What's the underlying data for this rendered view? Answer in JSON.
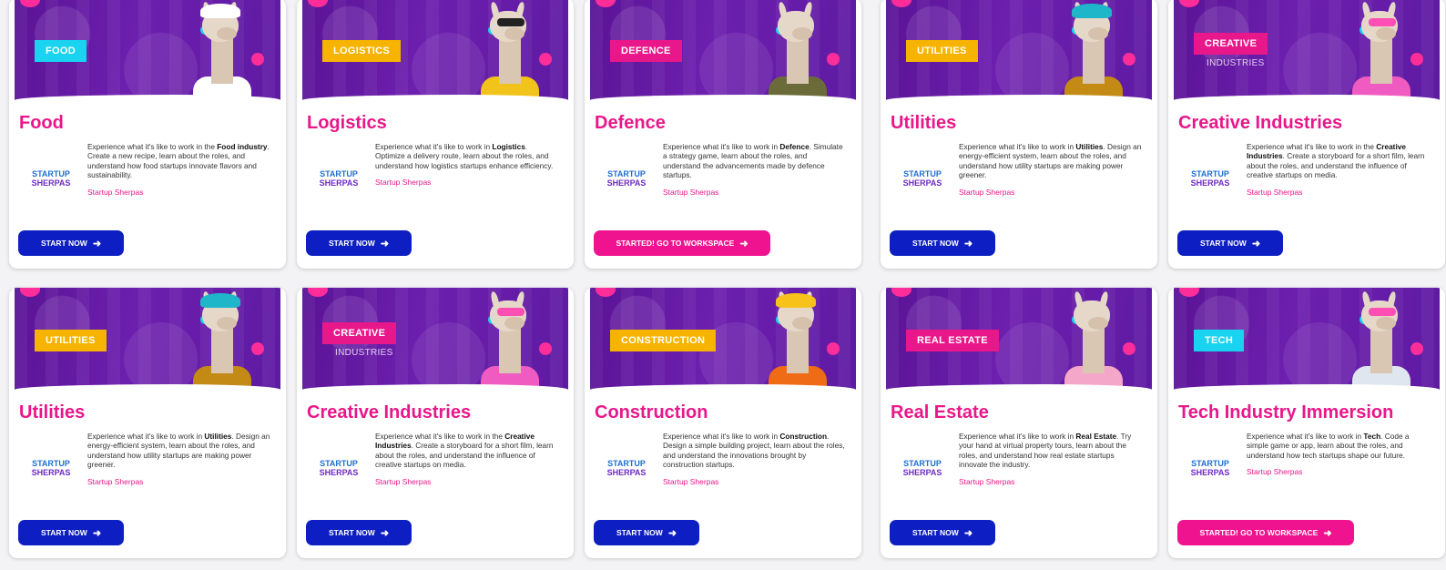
{
  "org_name": "Startup Sherpas",
  "logo": {
    "line1": "STARTUP",
    "line2": "SHERPAS"
  },
  "buttons": {
    "start": "START NOW",
    "started": "STARTED! GO TO WORKSPACE",
    "arrow_icon": "arrow-right-icon"
  },
  "cards": [
    {
      "tag": "FOOD",
      "tag_color": "#19d3f0",
      "tag_sub": "",
      "title": "Food",
      "desc_pre": "Experience what it's like to work in the ",
      "desc_bold": "Food industry",
      "desc_post": ". Create a new recipe, learn about the roles, and understand how food startups innovate flavors and sustainability.",
      "button": "start",
      "accessory": "chef-hat"
    },
    {
      "tag": "LOGISTICS",
      "tag_color": "#f6b400",
      "tag_sub": "",
      "title": "Logistics",
      "desc_pre": "Experience what it's like to work in ",
      "desc_bold": "Logistics",
      "desc_post": ". Optimize a delivery route, learn about the roles, and understand how logistics startups enhance efficiency.",
      "button": "start",
      "accessory": "sunglasses"
    },
    {
      "tag": "DEFENCE",
      "tag_color": "#e8178a",
      "tag_sub": "",
      "title": "Defence",
      "desc_pre": "Experience what it's like to work in ",
      "desc_bold": "Defence",
      "desc_post": ". Simulate a strategy game, learn about the roles, and understand the advancements made by defence startups.",
      "button": "started",
      "accessory": "military"
    },
    {
      "tag": "UTILITIES",
      "tag_color": "#f6b400",
      "tag_sub": "",
      "title": "Utilities",
      "desc_pre": "Experience what it's like to work in ",
      "desc_bold": "Utilities",
      "desc_post": ". Design an energy-efficient system, learn about the roles, and understand how utility startups are making power greener.",
      "button": "start",
      "accessory": "helmet"
    },
    {
      "tag": "CREATIVE",
      "tag_color": "#e8178a",
      "tag_sub": "INDUSTRIES",
      "title": "Creative Industries",
      "desc_pre": "Experience what it's like to work in the ",
      "desc_bold": "Creative Industries",
      "desc_post": ". Create a storyboard for a short film, learn about the roles, and understand the influence of creative startups on media.",
      "button": "start",
      "accessory": "pink-glasses"
    },
    {
      "tag": "UTILITIES",
      "tag_color": "#f6b400",
      "tag_sub": "",
      "title": "Utilities",
      "desc_pre": "Experience what it's like to work in ",
      "desc_bold": "Utilities",
      "desc_post": ". Design an energy-efficient system, learn about the roles, and understand how utility startups are making power greener.",
      "button": "start",
      "accessory": "helmet"
    },
    {
      "tag": "CREATIVE",
      "tag_color": "#e8178a",
      "tag_sub": "INDUSTRIES",
      "title": "Creative Industries",
      "desc_pre": "Experience what it's like to work in the ",
      "desc_bold": "Creative Industries",
      "desc_post": ". Create a storyboard for a short film, learn about the roles, and understand the influence of creative startups on media.",
      "button": "start",
      "accessory": "pink-glasses"
    },
    {
      "tag": "CONSTRUCTION",
      "tag_color": "#f6b400",
      "tag_sub": "",
      "title": "Construction",
      "desc_pre": "Experience what it's like to work in ",
      "desc_bold": "Construction",
      "desc_post": ". Design a simple building project, learn about the roles, and understand the innovations brought by construction startups.",
      "button": "start",
      "accessory": "hard-hat"
    },
    {
      "tag": "REAL ESTATE",
      "tag_color": "#e8178a",
      "tag_sub": "",
      "title": "Real Estate",
      "desc_pre": "Experience what it's like to work in ",
      "desc_bold": "Real Estate",
      "desc_post": ". Try your hand at virtual property tours, learn about the roles, and understand how real estate startups innovate the industry.",
      "button": "start",
      "accessory": "pink-suit"
    },
    {
      "tag": "TECH",
      "tag_color": "#19d3f0",
      "tag_sub": "",
      "title": "Tech Industry Immersion",
      "desc_pre": "Experience what it's like to work in ",
      "desc_bold": "Tech",
      "desc_post": ". Code a simple game or app, learn about the roles, and understand how tech startups shape our future.",
      "button": "started",
      "accessory": "laptop"
    }
  ]
}
